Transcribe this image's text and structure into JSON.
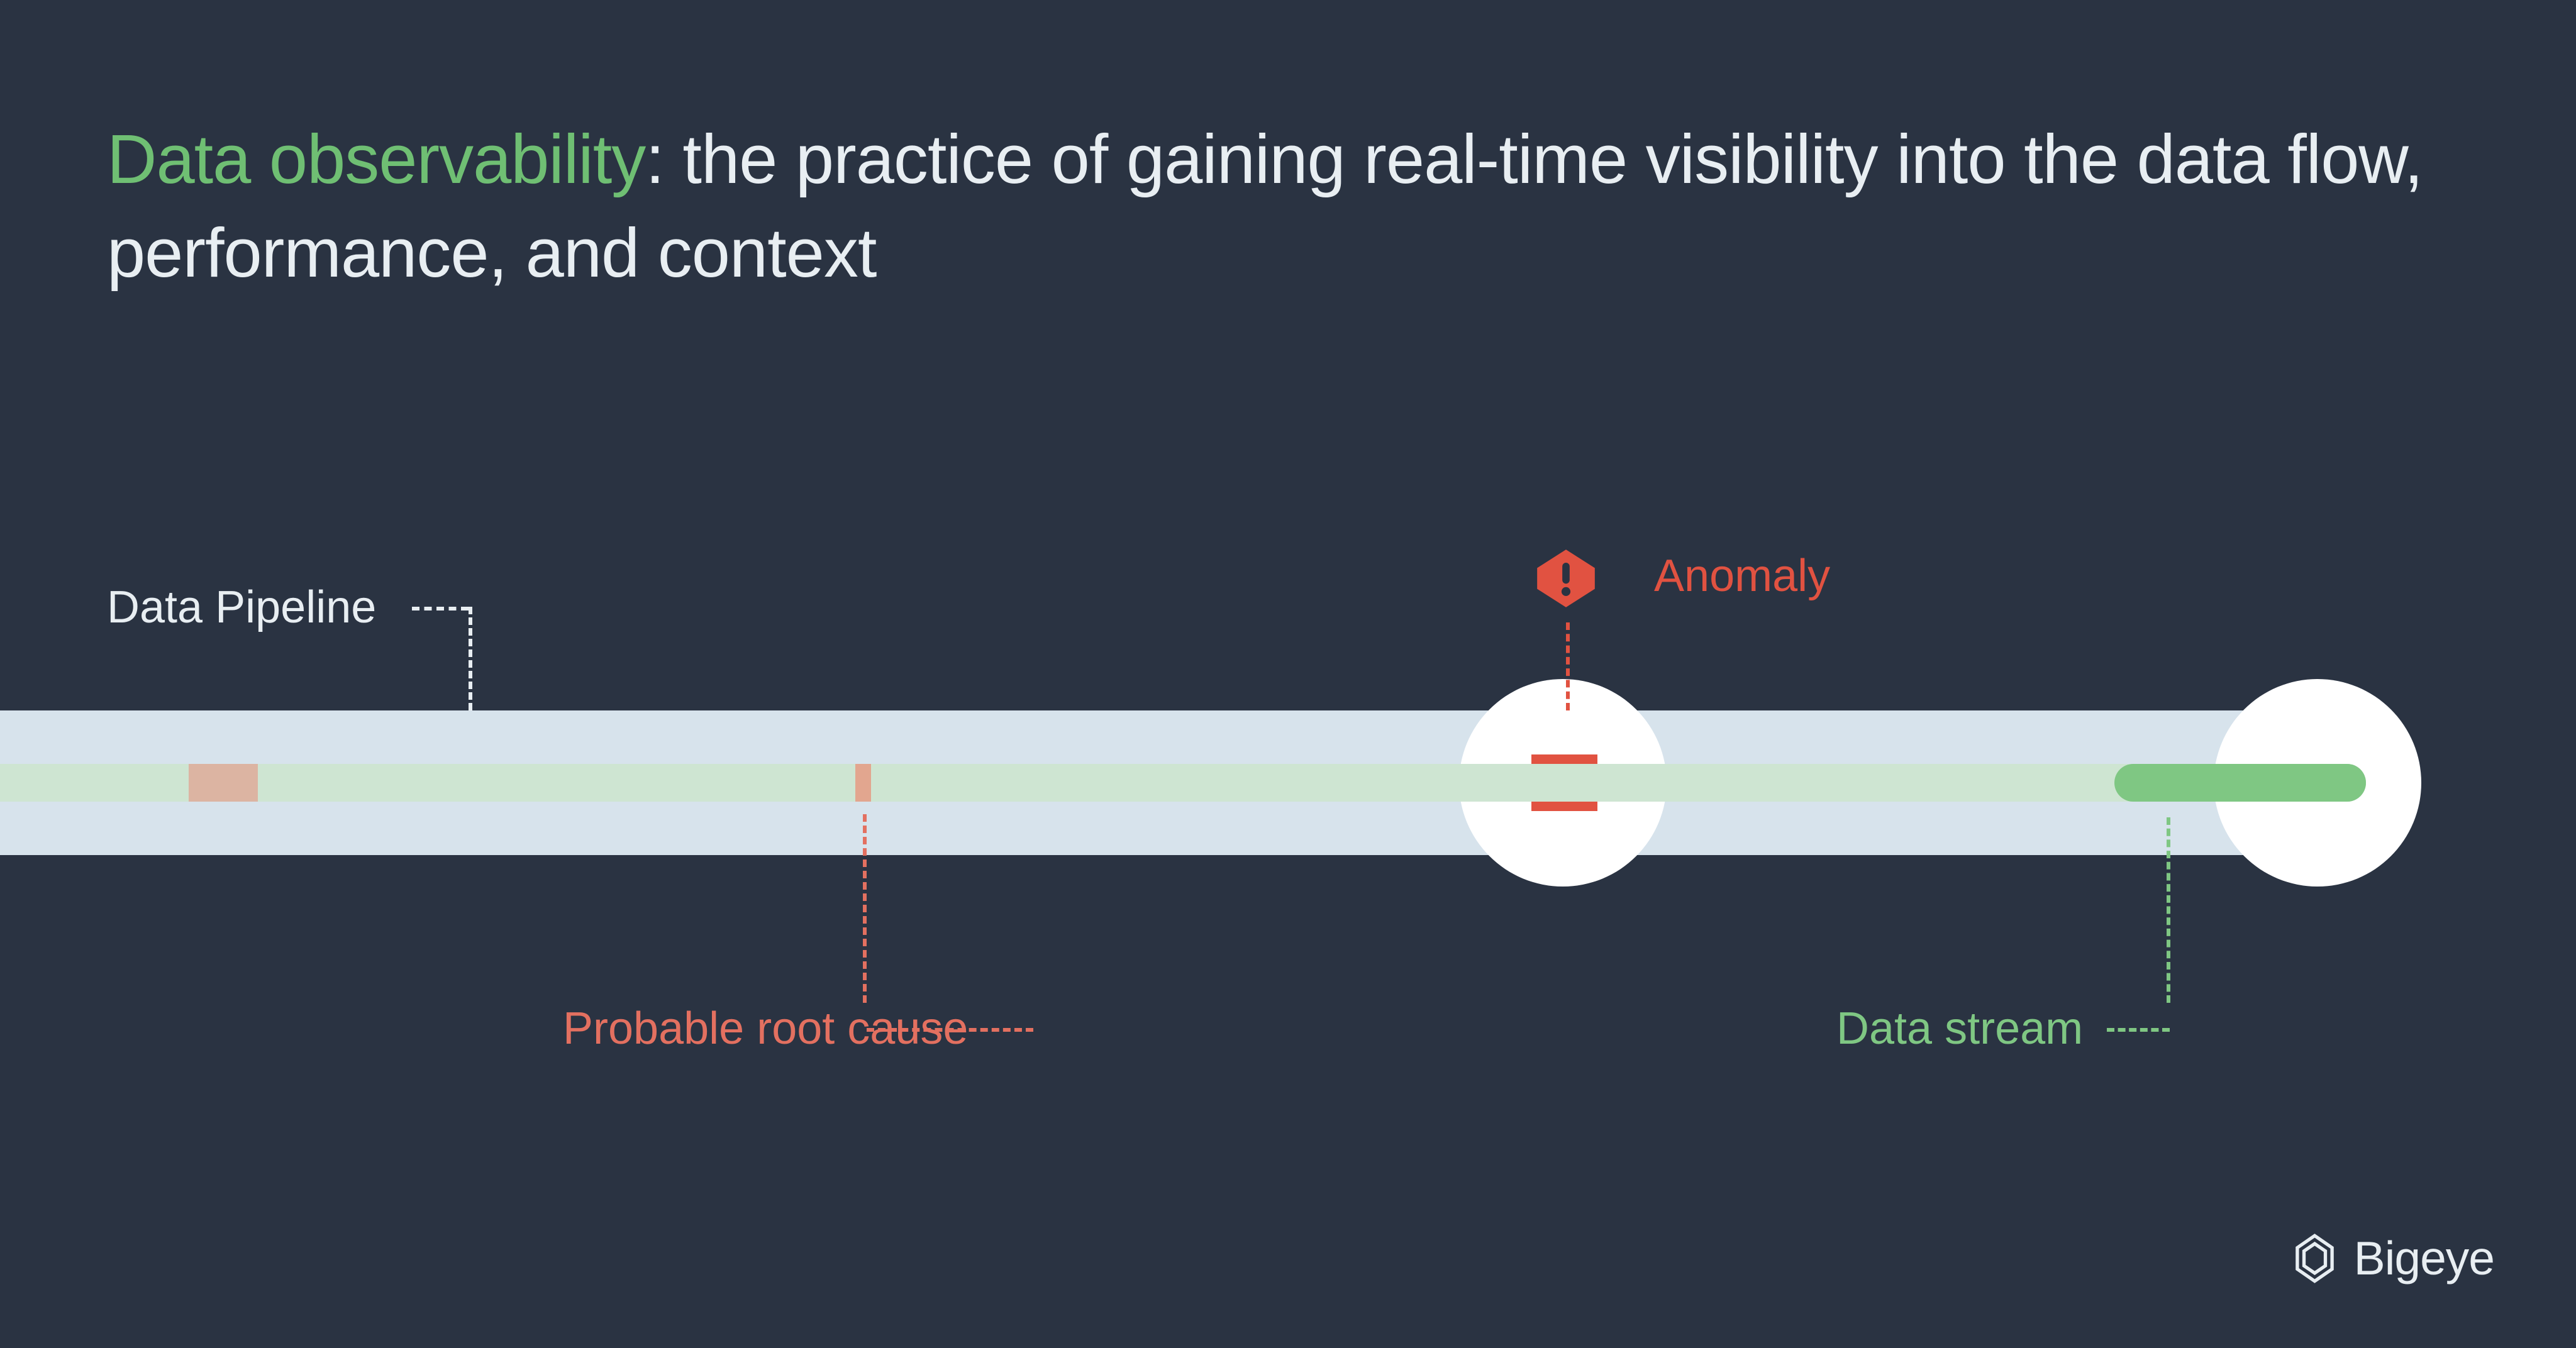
{
  "title": {
    "accent": "Data observability",
    "rest": ": the practice of gaining real-time visibility into the data flow, performance, and context"
  },
  "labels": {
    "pipeline": "Data Pipeline",
    "anomaly": "Anomaly",
    "root_cause": "Probable root cause",
    "stream": "Data stream"
  },
  "brand": {
    "name": "Bigeye"
  },
  "colors": {
    "bg": "#2a3342",
    "text": "#e8eef2",
    "accent_green": "#6fbf73",
    "pipe": "#d7e3ec",
    "stream_light": "#cee5d2",
    "stream_dark": "#7fc783",
    "warn": "#e15241",
    "warn_soft": "#e37060"
  }
}
